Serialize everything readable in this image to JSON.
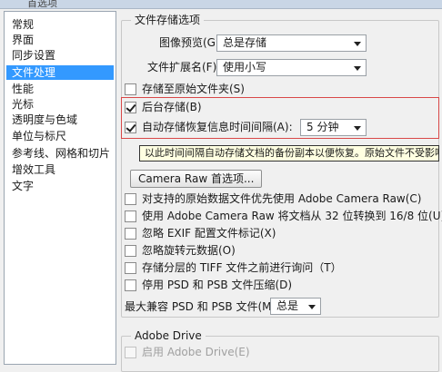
{
  "window": {
    "title": "首选项"
  },
  "sidebar": {
    "items": [
      {
        "label": "常规"
      },
      {
        "label": "界面"
      },
      {
        "label": "同步设置"
      },
      {
        "label": "文件处理"
      },
      {
        "label": "性能"
      },
      {
        "label": "光标"
      },
      {
        "label": "透明度与色域"
      },
      {
        "label": "单位与标尺"
      },
      {
        "label": "参考线、网格和切片"
      },
      {
        "label": "增效工具"
      },
      {
        "label": "文字"
      }
    ],
    "selected_index": 3
  },
  "file_saving": {
    "group_title": "文件存储选项",
    "image_preview_label": "图像预览(G):",
    "image_preview_value": "总是存储",
    "file_ext_label": "文件扩展名(F):",
    "file_ext_value": "使用小写",
    "save_to_original_label": "存储至原始文件夹(S)",
    "save_to_original_checked": false,
    "background_save_label": "后台存储(B)",
    "background_save_checked": true,
    "auto_save_label": "自动存储恢复信息时间间隔(A):",
    "auto_save_checked": true,
    "auto_save_interval_value": "5 分钟",
    "tooltip_text": "以此时间间隔自动存储文档的备份副本以便恢复。原始文件不受影响。"
  },
  "compatibility": {
    "camera_raw_button": "Camera Raw 首选项...",
    "options": [
      {
        "label": "对支持的原始数据文件优先使用 Adobe Camera Raw(C)",
        "checked": false
      },
      {
        "label": "使用 Adobe Camera Raw 将文档从 32 位转换到 16/8 位(U)",
        "checked": false
      },
      {
        "label": "忽略 EXIF 配置文件标记(X)",
        "checked": false
      },
      {
        "label": "忽略旋转元数据(O)",
        "checked": false
      },
      {
        "label": "存储分层的 TIFF 文件之前进行询问（T）",
        "checked": false
      },
      {
        "label": "停用 PSD 和 PSB 文件压缩(D)",
        "checked": false
      }
    ],
    "max_compat_label": "最大兼容 PSD 和 PSB 文件(M):",
    "max_compat_value": "总是"
  },
  "adobe_drive": {
    "group_title": "Adobe Drive",
    "enable_label": "启用 Adobe Drive(E)",
    "enable_checked": false
  }
}
